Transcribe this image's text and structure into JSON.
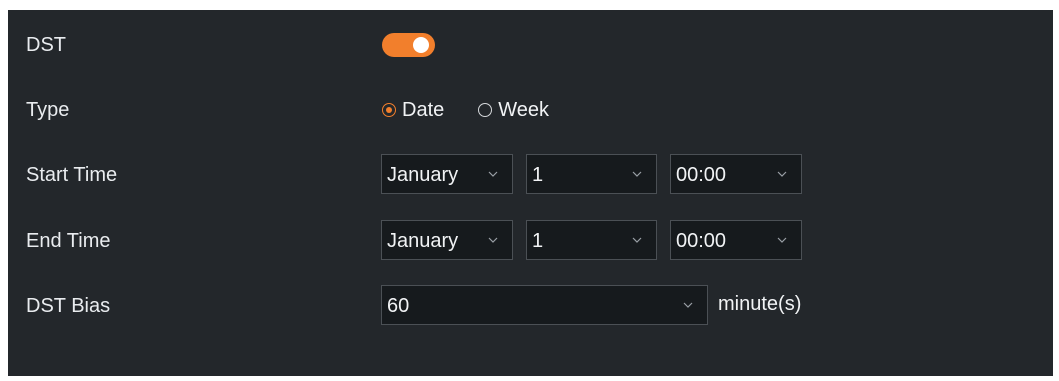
{
  "rows": {
    "dst": {
      "label": "DST",
      "enabled": true
    },
    "type": {
      "label": "Type",
      "options": [
        {
          "label": "Date",
          "selected": true
        },
        {
          "label": "Week",
          "selected": false
        }
      ]
    },
    "start_time": {
      "label": "Start Time",
      "month": "January",
      "day": "1",
      "time": "00:00"
    },
    "end_time": {
      "label": "End Time",
      "month": "January",
      "day": "1",
      "time": "00:00"
    },
    "dst_bias": {
      "label": "DST Bias",
      "value": "60",
      "unit": "minute(s)"
    }
  },
  "icons": {
    "dropdown": "chevron-down-icon",
    "radio": "radio-icon"
  },
  "colors": {
    "accent": "#f27f2c",
    "panel_bg": "#23272b",
    "field_bg": "#161a1d",
    "field_border": "#4b5055",
    "text": "#f1f3f5"
  }
}
